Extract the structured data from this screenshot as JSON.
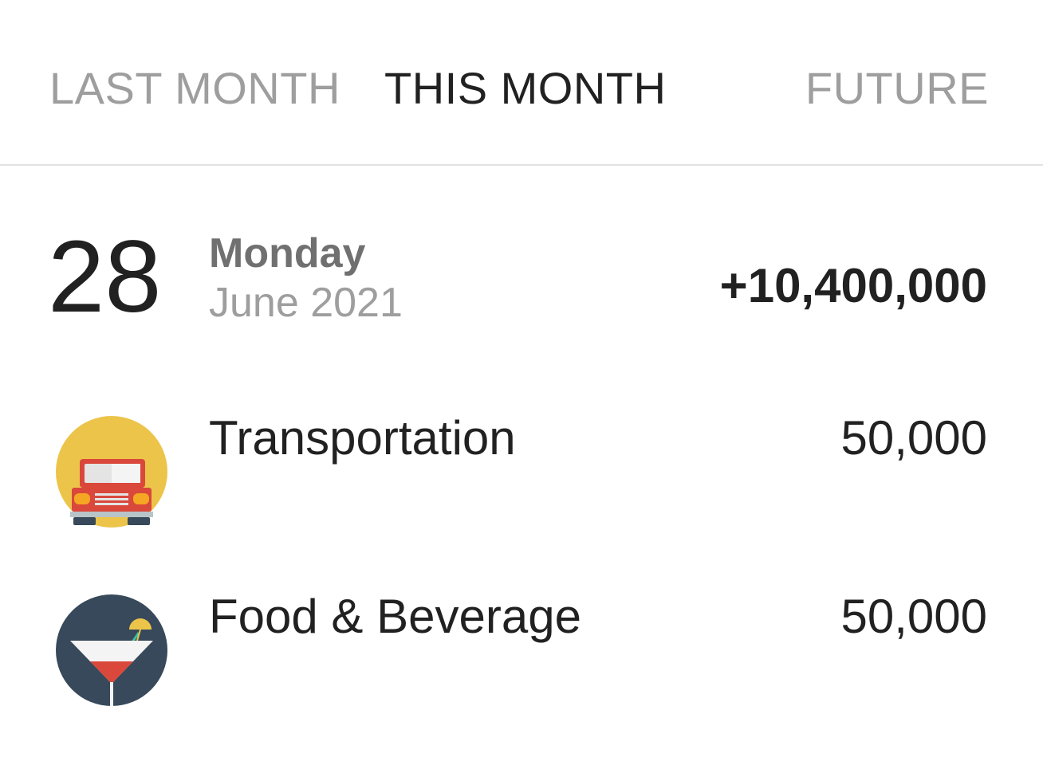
{
  "tabs": [
    {
      "label": "LAST MONTH",
      "active": false
    },
    {
      "label": "THIS MONTH",
      "active": true
    },
    {
      "label": "FUTURE",
      "active": false
    }
  ],
  "day": {
    "number": "28",
    "weekday": "Monday",
    "month_year": "June 2021",
    "total": "+10,400,000"
  },
  "transactions": [
    {
      "category": "Transportation",
      "amount": "50,000",
      "icon": "car-icon",
      "icon_bg": "#ECC44A"
    },
    {
      "category": "Food & Beverage",
      "amount": "50,000",
      "icon": "cocktail-icon",
      "icon_bg": "#37495A"
    }
  ],
  "colors": {
    "active_tab": "#212121",
    "inactive_tab": "#9e9e9e",
    "divider": "#e2e2e2"
  }
}
